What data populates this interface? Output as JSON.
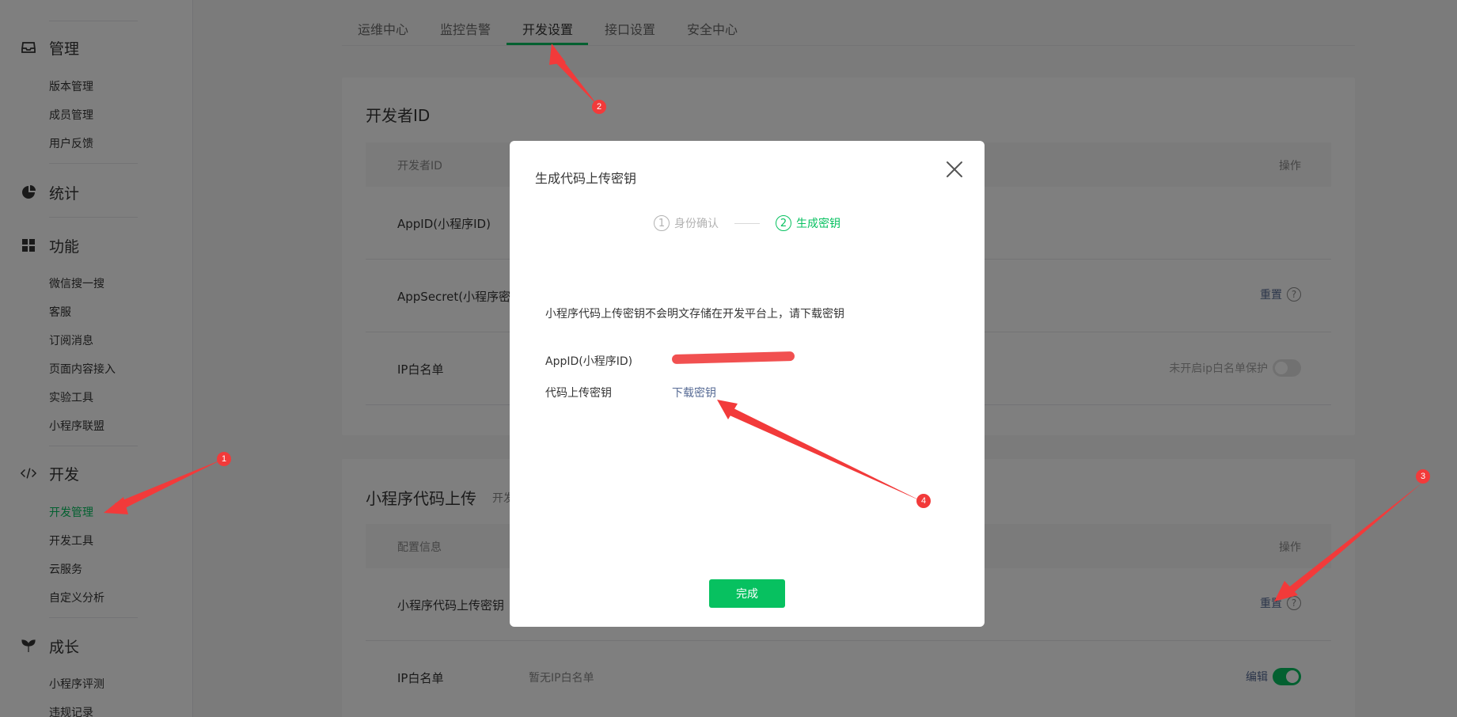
{
  "sidebar": {
    "groups": [
      {
        "title": "管理",
        "icon": "inbox-icon",
        "items": [
          "版本管理",
          "成员管理",
          "用户反馈"
        ]
      },
      {
        "title": "统计",
        "icon": "pie-chart-icon",
        "items": []
      },
      {
        "title": "功能",
        "icon": "grid-icon",
        "items": [
          "微信搜一搜",
          "客服",
          "订阅消息",
          "页面内容接入",
          "实验工具",
          "小程序联盟"
        ]
      },
      {
        "title": "开发",
        "icon": "code-icon",
        "items": [
          "开发管理",
          "开发工具",
          "云服务",
          "自定义分析"
        ]
      },
      {
        "title": "成长",
        "icon": "sprout-icon",
        "items": [
          "小程序评测",
          "违规记录"
        ]
      }
    ],
    "active_item": "开发管理"
  },
  "tabs": [
    "运维中心",
    "监控告警",
    "开发设置",
    "接口设置",
    "安全中心"
  ],
  "active_tab": "开发设置",
  "dev_id_card": {
    "title": "开发者ID",
    "col_name": "开发者ID",
    "col_op": "操作",
    "rows": [
      {
        "label": "AppID(小程序ID)",
        "op": ""
      },
      {
        "label": "AppSecret(小程序密钥)",
        "op": "重置"
      },
      {
        "label": "IP白名单",
        "op": "未开启ip白名单保护"
      }
    ]
  },
  "upload_card": {
    "title": "小程序代码上传",
    "subtitle": "开发",
    "col_name": "配置信息",
    "col_op": "操作",
    "rows": [
      {
        "label": "小程序代码上传密钥",
        "value": "",
        "op": "重置"
      },
      {
        "label": "IP白名单",
        "value": "暂无IP白名单",
        "op": "编辑"
      }
    ]
  },
  "modal": {
    "title": "生成代码上传密钥",
    "steps": [
      {
        "num": "1",
        "label": "身份确认"
      },
      {
        "num": "2",
        "label": "生成密钥"
      }
    ],
    "description": "小程序代码上传密钥不会明文存储在开发平台上，请下载密钥",
    "appid_label": "AppID(小程序ID)",
    "key_label": "代码上传密钥",
    "download_link": "下载密钥",
    "done_button": "完成"
  },
  "annotations": [
    "1",
    "2",
    "3",
    "4"
  ],
  "colors": {
    "accent": "#07c160",
    "link": "#576b95",
    "annotation": "#f23a3a"
  }
}
